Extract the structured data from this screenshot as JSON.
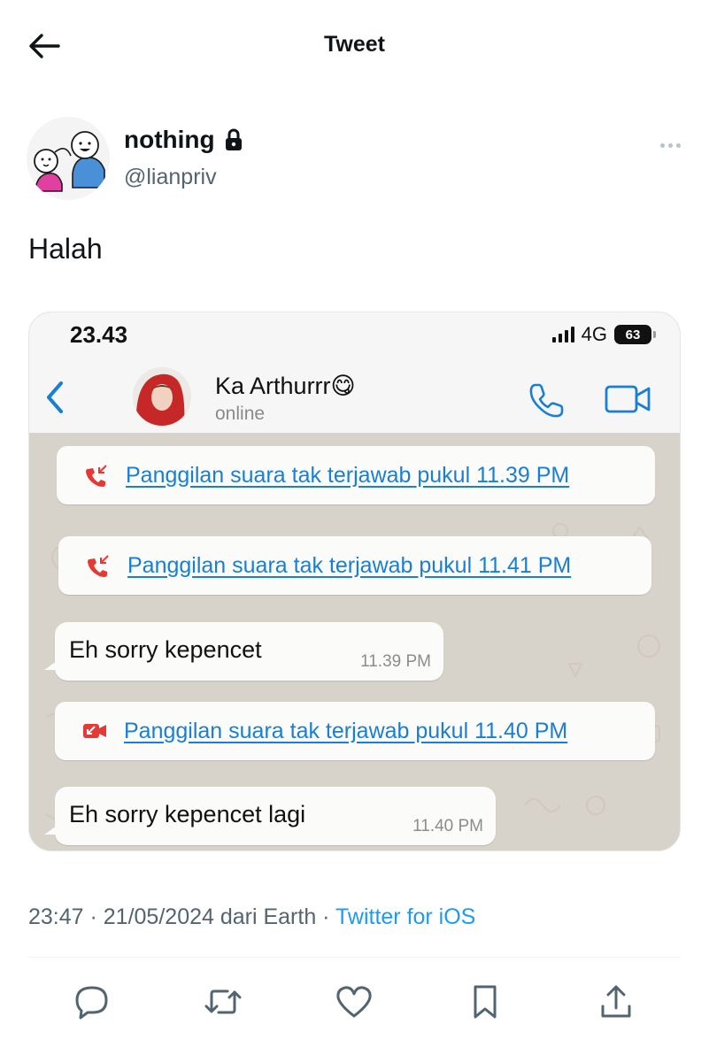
{
  "header": {
    "title": "Tweet",
    "back_icon": "arrow-left-icon"
  },
  "author": {
    "name": "nothing",
    "handle": "@lianpriv",
    "protected_icon": "lock-icon",
    "more_icon": "more-horizontal-icon"
  },
  "tweet": {
    "text": "Halah"
  },
  "screenshot": {
    "status_time": "23.43",
    "network": "4G",
    "battery": "63",
    "contact": {
      "name": "Ka Arthurrr😋",
      "status": "online"
    },
    "messages": [
      {
        "type": "call",
        "icon": "missed-voice-call-icon",
        "text": "Panggilan suara tak terjawab pukul 11.39 PM"
      },
      {
        "type": "call",
        "icon": "missed-voice-call-icon",
        "text": "Panggilan suara tak terjawab pukul 11.41 PM"
      },
      {
        "type": "text",
        "text": "Eh sorry kepencet",
        "time": "11.39 PM"
      },
      {
        "type": "call",
        "icon": "missed-video-call-icon",
        "text": "Panggilan suara tak terjawab pukul 11.40 PM"
      },
      {
        "type": "text",
        "text": "Eh sorry kepencet lagi",
        "time": "11.40 PM"
      }
    ],
    "colors": {
      "link_blue": "#1a7fd2",
      "missed_red": "#e53935",
      "chat_bg": "#d7d2ca"
    }
  },
  "meta": {
    "timestamp": "23:47 · 21/05/2024 dari Earth",
    "separator": " · ",
    "source": "Twitter for iOS"
  },
  "actions": [
    {
      "name": "reply",
      "icon": "reply-icon"
    },
    {
      "name": "retweet",
      "icon": "retweet-icon"
    },
    {
      "name": "like",
      "icon": "heart-icon"
    },
    {
      "name": "bookmark",
      "icon": "bookmark-icon"
    },
    {
      "name": "share",
      "icon": "share-icon"
    }
  ],
  "colors": {
    "text_primary": "#0f1419",
    "text_secondary": "#536471",
    "accent": "#1d9bf0"
  }
}
